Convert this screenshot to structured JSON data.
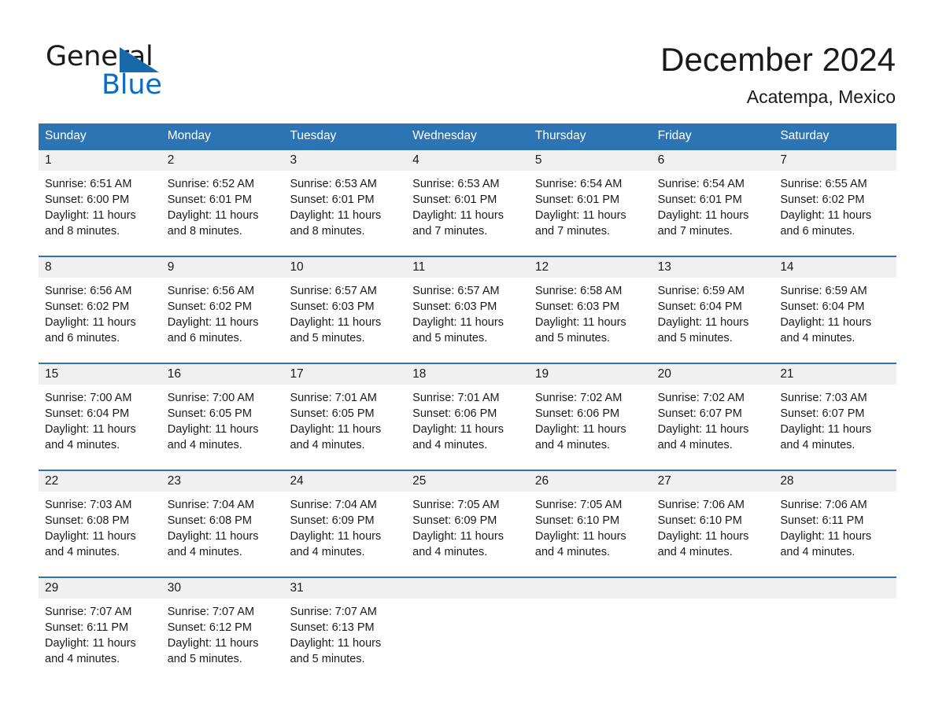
{
  "brand": {
    "name_part1": "General",
    "name_part2": "Blue",
    "triangle_color": "#1868ac",
    "blue_color": "#0a6cc4"
  },
  "header": {
    "month_title": "December 2024",
    "location": "Acatempa, Mexico",
    "accent_color": "#2c74b3",
    "number_band_color": "#f0f0f0"
  },
  "weekday_headers": [
    "Sunday",
    "Monday",
    "Tuesday",
    "Wednesday",
    "Thursday",
    "Friday",
    "Saturday"
  ],
  "weeks": [
    {
      "numbers": [
        "1",
        "2",
        "3",
        "4",
        "5",
        "6",
        "7"
      ],
      "cells": [
        {
          "sunrise": "Sunrise: 6:51 AM",
          "sunset": "Sunset: 6:00 PM",
          "daylight_line1": "Daylight: 11 hours",
          "daylight_line2": "and 8 minutes."
        },
        {
          "sunrise": "Sunrise: 6:52 AM",
          "sunset": "Sunset: 6:01 PM",
          "daylight_line1": "Daylight: 11 hours",
          "daylight_line2": "and 8 minutes."
        },
        {
          "sunrise": "Sunrise: 6:53 AM",
          "sunset": "Sunset: 6:01 PM",
          "daylight_line1": "Daylight: 11 hours",
          "daylight_line2": "and 8 minutes."
        },
        {
          "sunrise": "Sunrise: 6:53 AM",
          "sunset": "Sunset: 6:01 PM",
          "daylight_line1": "Daylight: 11 hours",
          "daylight_line2": "and 7 minutes."
        },
        {
          "sunrise": "Sunrise: 6:54 AM",
          "sunset": "Sunset: 6:01 PM",
          "daylight_line1": "Daylight: 11 hours",
          "daylight_line2": "and 7 minutes."
        },
        {
          "sunrise": "Sunrise: 6:54 AM",
          "sunset": "Sunset: 6:01 PM",
          "daylight_line1": "Daylight: 11 hours",
          "daylight_line2": "and 7 minutes."
        },
        {
          "sunrise": "Sunrise: 6:55 AM",
          "sunset": "Sunset: 6:02 PM",
          "daylight_line1": "Daylight: 11 hours",
          "daylight_line2": "and 6 minutes."
        }
      ]
    },
    {
      "numbers": [
        "8",
        "9",
        "10",
        "11",
        "12",
        "13",
        "14"
      ],
      "cells": [
        {
          "sunrise": "Sunrise: 6:56 AM",
          "sunset": "Sunset: 6:02 PM",
          "daylight_line1": "Daylight: 11 hours",
          "daylight_line2": "and 6 minutes."
        },
        {
          "sunrise": "Sunrise: 6:56 AM",
          "sunset": "Sunset: 6:02 PM",
          "daylight_line1": "Daylight: 11 hours",
          "daylight_line2": "and 6 minutes."
        },
        {
          "sunrise": "Sunrise: 6:57 AM",
          "sunset": "Sunset: 6:03 PM",
          "daylight_line1": "Daylight: 11 hours",
          "daylight_line2": "and 5 minutes."
        },
        {
          "sunrise": "Sunrise: 6:57 AM",
          "sunset": "Sunset: 6:03 PM",
          "daylight_line1": "Daylight: 11 hours",
          "daylight_line2": "and 5 minutes."
        },
        {
          "sunrise": "Sunrise: 6:58 AM",
          "sunset": "Sunset: 6:03 PM",
          "daylight_line1": "Daylight: 11 hours",
          "daylight_line2": "and 5 minutes."
        },
        {
          "sunrise": "Sunrise: 6:59 AM",
          "sunset": "Sunset: 6:04 PM",
          "daylight_line1": "Daylight: 11 hours",
          "daylight_line2": "and 5 minutes."
        },
        {
          "sunrise": "Sunrise: 6:59 AM",
          "sunset": "Sunset: 6:04 PM",
          "daylight_line1": "Daylight: 11 hours",
          "daylight_line2": "and 4 minutes."
        }
      ]
    },
    {
      "numbers": [
        "15",
        "16",
        "17",
        "18",
        "19",
        "20",
        "21"
      ],
      "cells": [
        {
          "sunrise": "Sunrise: 7:00 AM",
          "sunset": "Sunset: 6:04 PM",
          "daylight_line1": "Daylight: 11 hours",
          "daylight_line2": "and 4 minutes."
        },
        {
          "sunrise": "Sunrise: 7:00 AM",
          "sunset": "Sunset: 6:05 PM",
          "daylight_line1": "Daylight: 11 hours",
          "daylight_line2": "and 4 minutes."
        },
        {
          "sunrise": "Sunrise: 7:01 AM",
          "sunset": "Sunset: 6:05 PM",
          "daylight_line1": "Daylight: 11 hours",
          "daylight_line2": "and 4 minutes."
        },
        {
          "sunrise": "Sunrise: 7:01 AM",
          "sunset": "Sunset: 6:06 PM",
          "daylight_line1": "Daylight: 11 hours",
          "daylight_line2": "and 4 minutes."
        },
        {
          "sunrise": "Sunrise: 7:02 AM",
          "sunset": "Sunset: 6:06 PM",
          "daylight_line1": "Daylight: 11 hours",
          "daylight_line2": "and 4 minutes."
        },
        {
          "sunrise": "Sunrise: 7:02 AM",
          "sunset": "Sunset: 6:07 PM",
          "daylight_line1": "Daylight: 11 hours",
          "daylight_line2": "and 4 minutes."
        },
        {
          "sunrise": "Sunrise: 7:03 AM",
          "sunset": "Sunset: 6:07 PM",
          "daylight_line1": "Daylight: 11 hours",
          "daylight_line2": "and 4 minutes."
        }
      ]
    },
    {
      "numbers": [
        "22",
        "23",
        "24",
        "25",
        "26",
        "27",
        "28"
      ],
      "cells": [
        {
          "sunrise": "Sunrise: 7:03 AM",
          "sunset": "Sunset: 6:08 PM",
          "daylight_line1": "Daylight: 11 hours",
          "daylight_line2": "and 4 minutes."
        },
        {
          "sunrise": "Sunrise: 7:04 AM",
          "sunset": "Sunset: 6:08 PM",
          "daylight_line1": "Daylight: 11 hours",
          "daylight_line2": "and 4 minutes."
        },
        {
          "sunrise": "Sunrise: 7:04 AM",
          "sunset": "Sunset: 6:09 PM",
          "daylight_line1": "Daylight: 11 hours",
          "daylight_line2": "and 4 minutes."
        },
        {
          "sunrise": "Sunrise: 7:05 AM",
          "sunset": "Sunset: 6:09 PM",
          "daylight_line1": "Daylight: 11 hours",
          "daylight_line2": "and 4 minutes."
        },
        {
          "sunrise": "Sunrise: 7:05 AM",
          "sunset": "Sunset: 6:10 PM",
          "daylight_line1": "Daylight: 11 hours",
          "daylight_line2": "and 4 minutes."
        },
        {
          "sunrise": "Sunrise: 7:06 AM",
          "sunset": "Sunset: 6:10 PM",
          "daylight_line1": "Daylight: 11 hours",
          "daylight_line2": "and 4 minutes."
        },
        {
          "sunrise": "Sunrise: 7:06 AM",
          "sunset": "Sunset: 6:11 PM",
          "daylight_line1": "Daylight: 11 hours",
          "daylight_line2": "and 4 minutes."
        }
      ]
    },
    {
      "numbers": [
        "29",
        "30",
        "31",
        "",
        "",
        "",
        ""
      ],
      "cells": [
        {
          "sunrise": "Sunrise: 7:07 AM",
          "sunset": "Sunset: 6:11 PM",
          "daylight_line1": "Daylight: 11 hours",
          "daylight_line2": "and 4 minutes."
        },
        {
          "sunrise": "Sunrise: 7:07 AM",
          "sunset": "Sunset: 6:12 PM",
          "daylight_line1": "Daylight: 11 hours",
          "daylight_line2": "and 5 minutes."
        },
        {
          "sunrise": "Sunrise: 7:07 AM",
          "sunset": "Sunset: 6:13 PM",
          "daylight_line1": "Daylight: 11 hours",
          "daylight_line2": "and 5 minutes."
        },
        {
          "sunrise": "",
          "sunset": "",
          "daylight_line1": "",
          "daylight_line2": ""
        },
        {
          "sunrise": "",
          "sunset": "",
          "daylight_line1": "",
          "daylight_line2": ""
        },
        {
          "sunrise": "",
          "sunset": "",
          "daylight_line1": "",
          "daylight_line2": ""
        },
        {
          "sunrise": "",
          "sunset": "",
          "daylight_line1": "",
          "daylight_line2": ""
        }
      ]
    }
  ]
}
